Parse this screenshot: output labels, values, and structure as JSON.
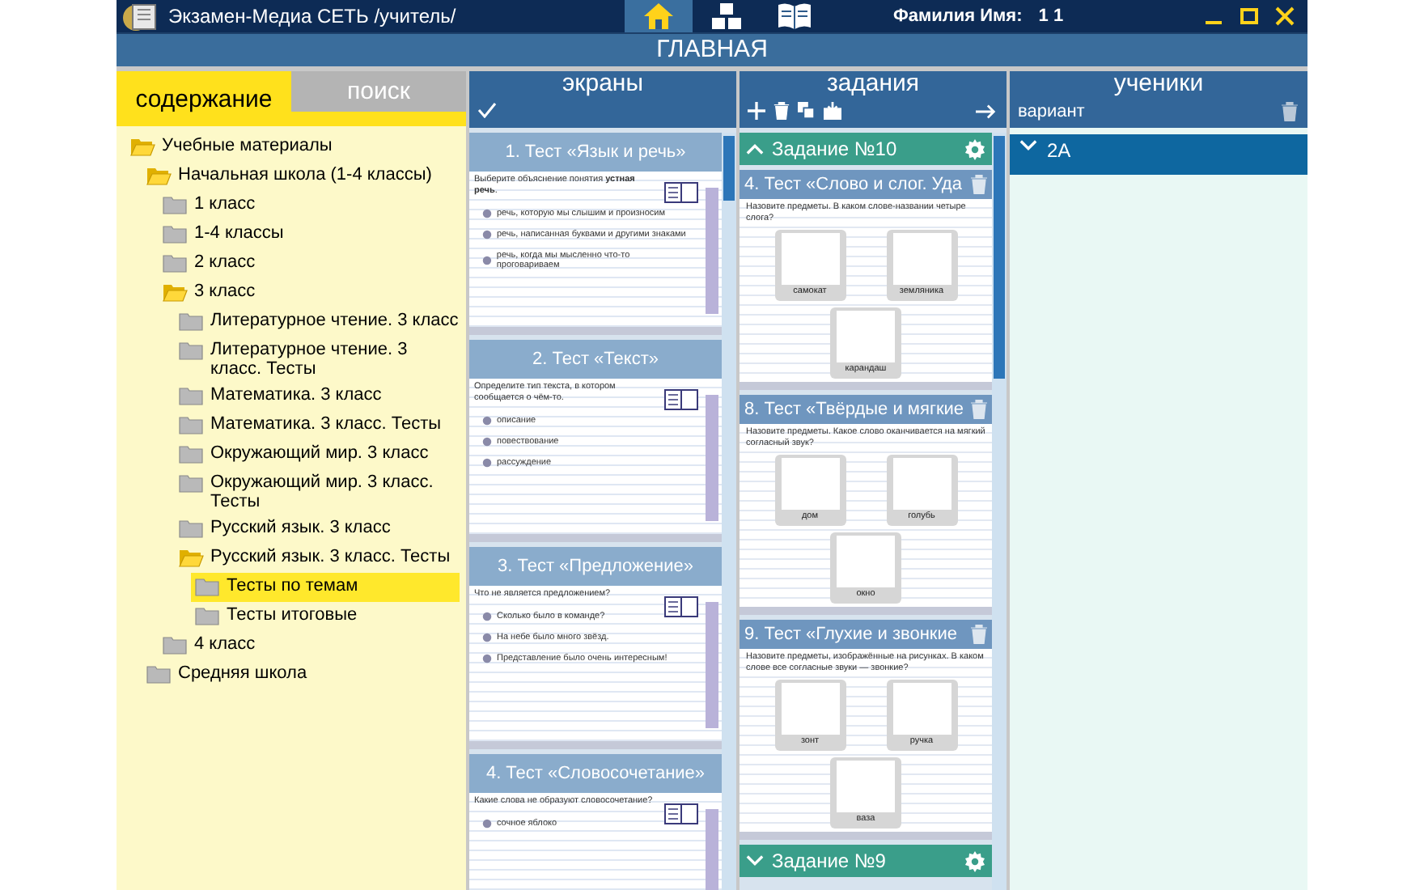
{
  "window": {
    "title": "Экзамен-Медиа СЕТЬ /учитель/",
    "user_label": "Фамилия Имя:",
    "user_value": "1 1"
  },
  "nav": [
    {
      "kind": "home",
      "selected": true
    },
    {
      "kind": "blocks",
      "selected": false
    },
    {
      "kind": "book",
      "selected": false
    }
  ],
  "page_title": "ГЛАВНАЯ",
  "left_tabs": [
    {
      "label": "содержание",
      "selected": true
    },
    {
      "label": "поиск",
      "selected": false
    }
  ],
  "tree": [
    {
      "label": "Учебные материалы",
      "expanded": true,
      "selected": false,
      "children": [
        {
          "label": "Начальная школа (1-4 классы)",
          "expanded": true,
          "selected": false,
          "children": [
            {
              "label": "1 класс",
              "expanded": false,
              "selected": false
            },
            {
              "label": "1-4 классы",
              "expanded": false,
              "selected": false
            },
            {
              "label": "2 класс",
              "expanded": false,
              "selected": false
            },
            {
              "label": "3 класс",
              "expanded": true,
              "selected": false,
              "children": [
                {
                  "label": "Литературное чтение. 3 класс",
                  "expanded": false,
                  "selected": false
                },
                {
                  "label": "Литературное чтение. 3 класс. Тесты",
                  "expanded": false,
                  "selected": false
                },
                {
                  "label": "Математика. 3 класс",
                  "expanded": false,
                  "selected": false
                },
                {
                  "label": "Математика. 3 класс. Тесты",
                  "expanded": false,
                  "selected": false
                },
                {
                  "label": "Окружающий мир. 3 класс",
                  "expanded": false,
                  "selected": false
                },
                {
                  "label": "Окружающий мир. 3 класс. Тесты",
                  "expanded": false,
                  "selected": false
                },
                {
                  "label": "Русский язык. 3 класс",
                  "expanded": false,
                  "selected": false
                },
                {
                  "label": "Русский язык. 3 класс. Тесты",
                  "expanded": true,
                  "selected": false,
                  "children": [
                    {
                      "label": "Тесты по темам",
                      "expanded": false,
                      "selected": true
                    },
                    {
                      "label": "Тесты итоговые",
                      "expanded": false,
                      "selected": false
                    }
                  ]
                }
              ]
            },
            {
              "label": "4 класс",
              "expanded": false,
              "selected": false
            }
          ]
        },
        {
          "label": "Средняя школа",
          "expanded": false,
          "selected": false
        }
      ]
    }
  ],
  "screens": {
    "title": "экраны",
    "cards": [
      {
        "title": "1. Тест «Язык и речь»",
        "question": "Выберите объяснение понятия **устная речь**.",
        "options": [
          "речь, которую мы слышим и произносим",
          "речь, написанная буквами и другими знаками",
          "речь, когда мы мысленно что-то проговариваем"
        ]
      },
      {
        "title": "2. Тест «Текст»",
        "question": "Определите тип текста, в котором сообщается о чём-то.",
        "options": [
          "описание",
          "повествование",
          "рассуждение"
        ]
      },
      {
        "title": "3. Тест «Предложение»",
        "question": "Что не является предложением?",
        "options": [
          "Сколько было в команде?",
          "На небе было много звёзд.",
          "Представление было очень интересным!"
        ]
      },
      {
        "title": "4. Тест «Словосочетание»",
        "question": "Какие слова не образуют словосочетание?",
        "options": [
          "сочное яблоко"
        ]
      }
    ]
  },
  "tasks": {
    "title": "задания",
    "groups": [
      {
        "title": "Задание №10",
        "expanded": true,
        "cards": [
          {
            "title": "4. Тест «Слово и слог. Уда",
            "question": "Назовите предметы. В каком слове-названии четыре слога?",
            "pictures": [
              "самокат",
              "земляника",
              "карандаш"
            ]
          },
          {
            "title": "8. Тест «Твёрдые и мягкие",
            "question": "Назовите предметы. Какое слово оканчивается на мягкий согласный звук?",
            "pictures": [
              "дом",
              "голубь",
              "окно"
            ]
          },
          {
            "title": "9. Тест «Глухие и звонкие",
            "question": "Назовите предметы, изображённые на рисунках. В каком слове все согласные звуки — звонкие?",
            "pictures": [
              "зонт",
              "ручка",
              "ваза"
            ]
          }
        ]
      },
      {
        "title": "Задание №9",
        "expanded": false
      }
    ]
  },
  "students": {
    "title": "ученики",
    "subtitle": "вариант",
    "groups": [
      {
        "title": "2А",
        "expanded": false
      }
    ]
  }
}
